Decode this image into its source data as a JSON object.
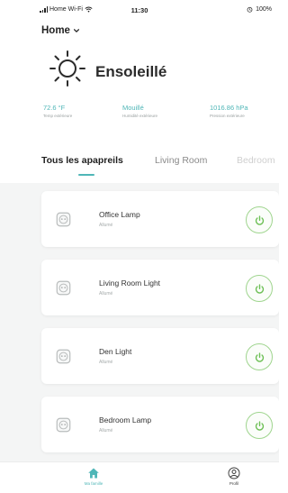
{
  "status_bar": {
    "carrier": "Home Wi-Fi",
    "time": "11:30",
    "battery": "100%"
  },
  "header": {
    "home_label": "Home",
    "weather": {
      "icon": "sun-icon",
      "condition": "Ensoleillé",
      "stats": [
        {
          "value": "72.6 °F",
          "label": "Temp extérieure"
        },
        {
          "value": "Mouillé",
          "label": "Humidité extérieure"
        },
        {
          "value": "1016.86 hPa",
          "label": "Pression extérieure"
        }
      ]
    }
  },
  "tabs": [
    "Tous les apapreils",
    "Living Room",
    "Bedroom"
  ],
  "active_tab": 0,
  "devices": [
    {
      "name": "Office Lamp",
      "status": "Allumé",
      "icon": "smart-plug-icon",
      "power": "on"
    },
    {
      "name": "Living Room Light",
      "status": "Allumé",
      "icon": "smart-plug-icon",
      "power": "on"
    },
    {
      "name": "Den Light",
      "status": "Allumé",
      "icon": "smart-plug-icon",
      "power": "on"
    },
    {
      "name": "Bedroom Lamp",
      "status": "Allumé",
      "icon": "smart-plug-icon",
      "power": "on"
    }
  ],
  "bottom_nav": [
    {
      "label": "Ma famille",
      "icon": "home-icon",
      "active": true
    },
    {
      "label": "Profil",
      "icon": "profile-icon",
      "active": false
    }
  ],
  "colors": {
    "accent": "#4fb6b7",
    "power_on": "#6cbf54",
    "background": "#f4f5f5"
  }
}
